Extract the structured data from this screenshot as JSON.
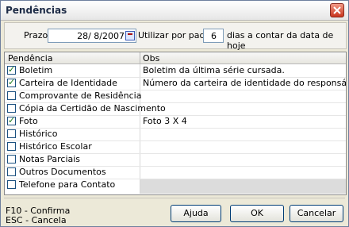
{
  "window": {
    "title": "Pendências"
  },
  "prazo": {
    "label": "Prazo",
    "date_value": "28/ 8/2007",
    "utilizar_label": "Utilizar por padrão",
    "dias_value": "6",
    "dias_label": "dias a contar da data de hoje"
  },
  "table": {
    "columns": [
      "Pendência",
      "Obs"
    ],
    "rows": [
      {
        "name": "Boletim",
        "obs": "Boletim da última série cursada.",
        "checked": true
      },
      {
        "name": "Carteira de Identidade",
        "obs": "Número da carteira de identidade do responsável.",
        "checked": true
      },
      {
        "name": "Comprovante de Residência",
        "obs": "",
        "checked": false
      },
      {
        "name": "Cópia da Certidão de Nascimento",
        "obs": "",
        "checked": false
      },
      {
        "name": "Foto",
        "obs": "Foto 3 X 4",
        "checked": true
      },
      {
        "name": "Histórico",
        "obs": "",
        "checked": false
      },
      {
        "name": "Histórico Escolar",
        "obs": "",
        "checked": false
      },
      {
        "name": "Notas Parciais",
        "obs": "",
        "checked": false
      },
      {
        "name": "Outros Documentos",
        "obs": "",
        "checked": false
      },
      {
        "name": "Telefone para Contato",
        "obs": "",
        "checked": false
      }
    ]
  },
  "footer": {
    "hint_confirm": "F10 - Confirma",
    "hint_cancel": "ESC - Cancela",
    "buttons": {
      "help": "Ajuda",
      "ok": "OK",
      "cancel": "Cancelar"
    }
  },
  "icons": {
    "close": "close-icon",
    "calendar": "calendar-icon",
    "checkbox": "checkbox-icon"
  }
}
